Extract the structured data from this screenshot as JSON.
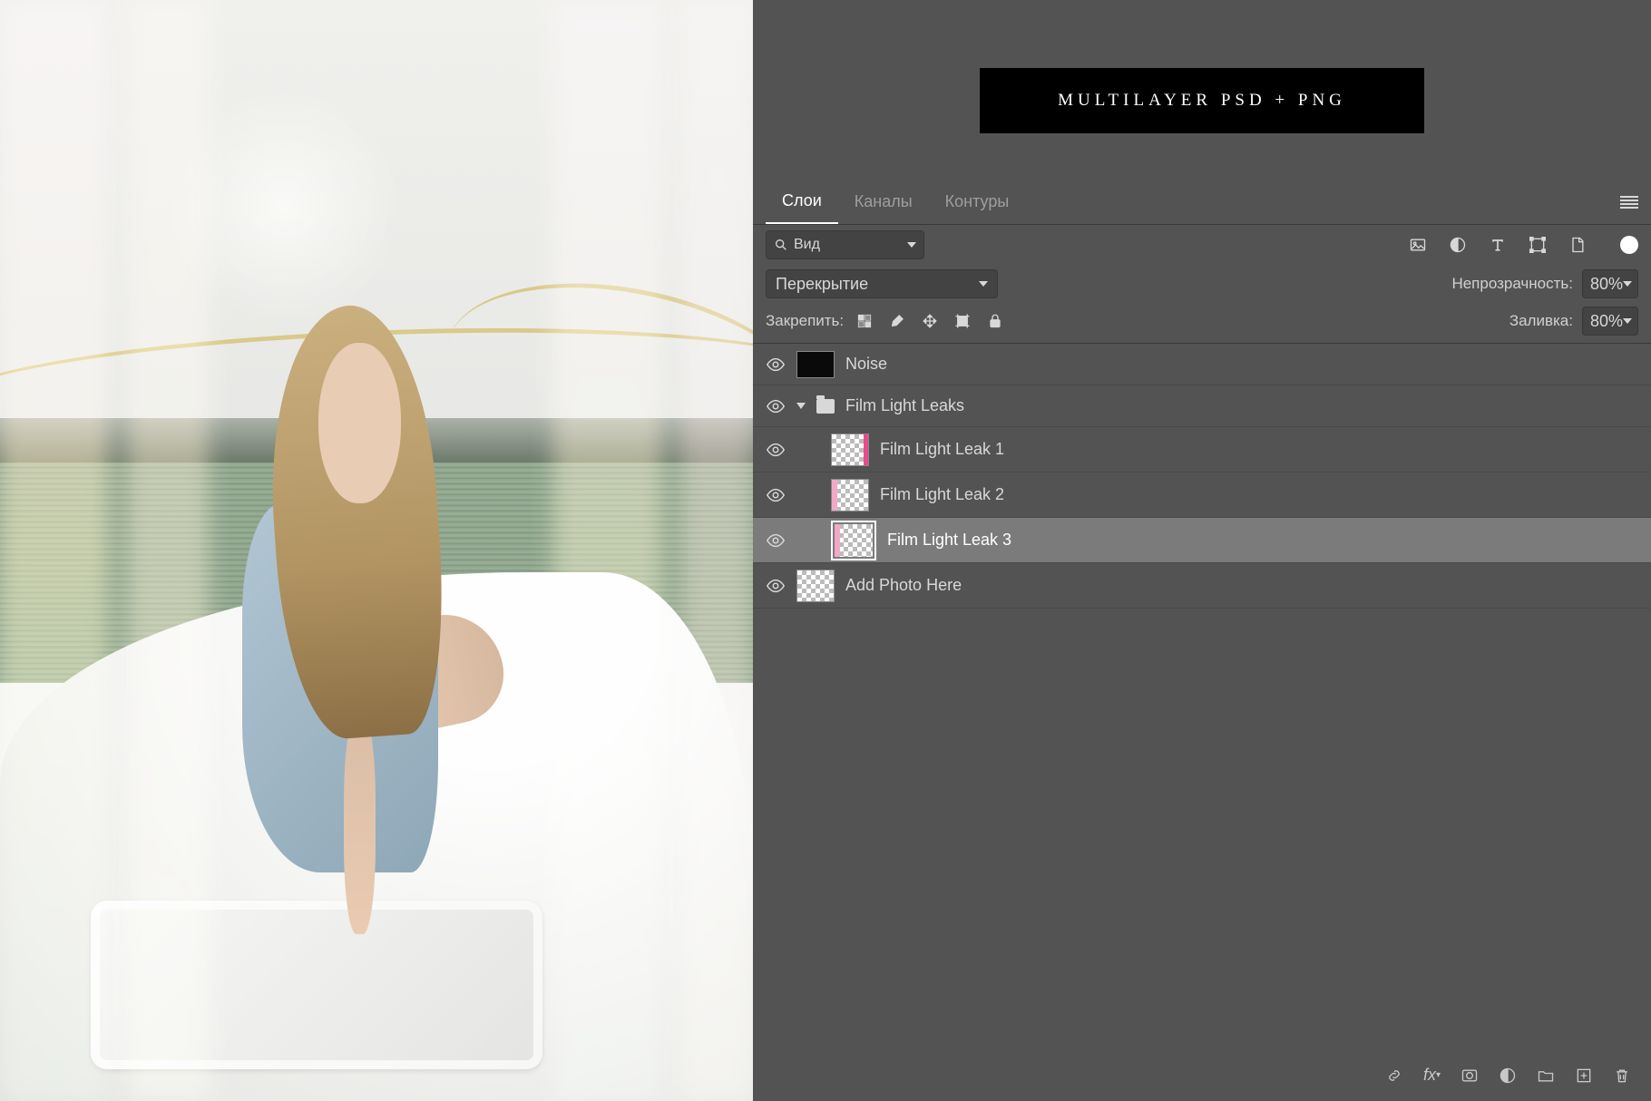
{
  "promo": {
    "title": "MULTILAYER PSD + PNG"
  },
  "tabs": {
    "layers": "Слои",
    "channels": "Каналы",
    "paths": "Контуры"
  },
  "search": {
    "value": "Вид"
  },
  "blend": {
    "mode": "Перекрытие",
    "opacityLabel": "Непрозрачность:",
    "opacityValue": "80%"
  },
  "lock": {
    "label": "Закрепить:",
    "fillLabel": "Заливка:",
    "fillValue": "80%"
  },
  "layers": {
    "noise": "Noise",
    "group": "Film Light Leaks",
    "leak1": "Film Light Leak 1",
    "leak2": "Film Light Leak 2",
    "leak3": "Film Light Leak 3",
    "addPhoto": "Add Photo Here"
  }
}
